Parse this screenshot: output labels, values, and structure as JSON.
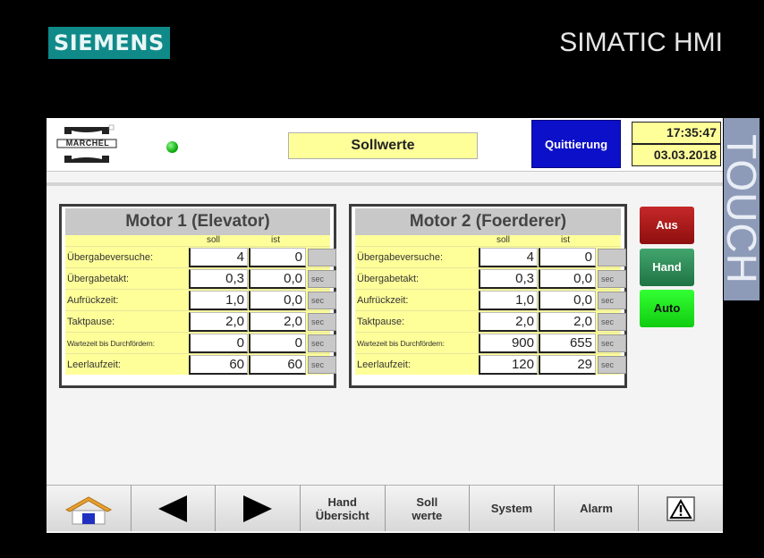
{
  "bezel": {
    "brand": "SIEMENS",
    "product": "SIMATIC HMI",
    "touch_label": "TOUCH"
  },
  "header": {
    "logo_text": "MARCHEL",
    "status_color": "#10b010",
    "title": "Sollwerte",
    "ack_button": "Quittierung",
    "time": "17:35:47",
    "date": "03.03.2018"
  },
  "col_soll": "soll",
  "col_ist": "ist",
  "motor1": {
    "title": "Motor 1 (Elevator)",
    "rows": [
      {
        "label": "Übergabeversuche:",
        "soll": "4",
        "ist": "0",
        "unit": ""
      },
      {
        "label": "Übergabetakt:",
        "soll": "0,3",
        "ist": "0,0",
        "unit": "sec"
      },
      {
        "label": "Aufrückzeit:",
        "soll": "1,0",
        "ist": "0,0",
        "unit": "sec"
      },
      {
        "label": "Taktpause:",
        "soll": "2,0",
        "ist": "2,0",
        "unit": "sec"
      },
      {
        "label": "Wartezeit bis Durchfördern:",
        "soll": "0",
        "ist": "0",
        "unit": "sec"
      },
      {
        "label": "Leerlaufzeit:",
        "soll": "60",
        "ist": "60",
        "unit": "sec"
      }
    ]
  },
  "motor2": {
    "title": "Motor 2 (Foerderer)",
    "rows": [
      {
        "label": "Übergabeversuche:",
        "soll": "4",
        "ist": "0",
        "unit": ""
      },
      {
        "label": "Übergabetakt:",
        "soll": "0,3",
        "ist": "0,0",
        "unit": "sec"
      },
      {
        "label": "Aufrückzeit:",
        "soll": "1,0",
        "ist": "0,0",
        "unit": "sec"
      },
      {
        "label": "Taktpause:",
        "soll": "2,0",
        "ist": "2,0",
        "unit": "sec"
      },
      {
        "label": "Wartezeit bis Durchfördern:",
        "soll": "900",
        "ist": "655",
        "unit": "sec"
      },
      {
        "label": "Leerlaufzeit:",
        "soll": "120",
        "ist": "29",
        "unit": "sec"
      }
    ]
  },
  "modes": {
    "aus": "Aus",
    "hand": "Hand",
    "auto": "Auto"
  },
  "nav": {
    "home_icon": "home-icon",
    "prev_icon": "arrow-left-icon",
    "next_icon": "arrow-right-icon",
    "hand_line1": "Hand",
    "hand_line2": "Übersicht",
    "soll_line1": "Soll",
    "soll_line2": "werte",
    "system": "System",
    "alarm": "Alarm",
    "warning_icon": "warning-icon"
  }
}
